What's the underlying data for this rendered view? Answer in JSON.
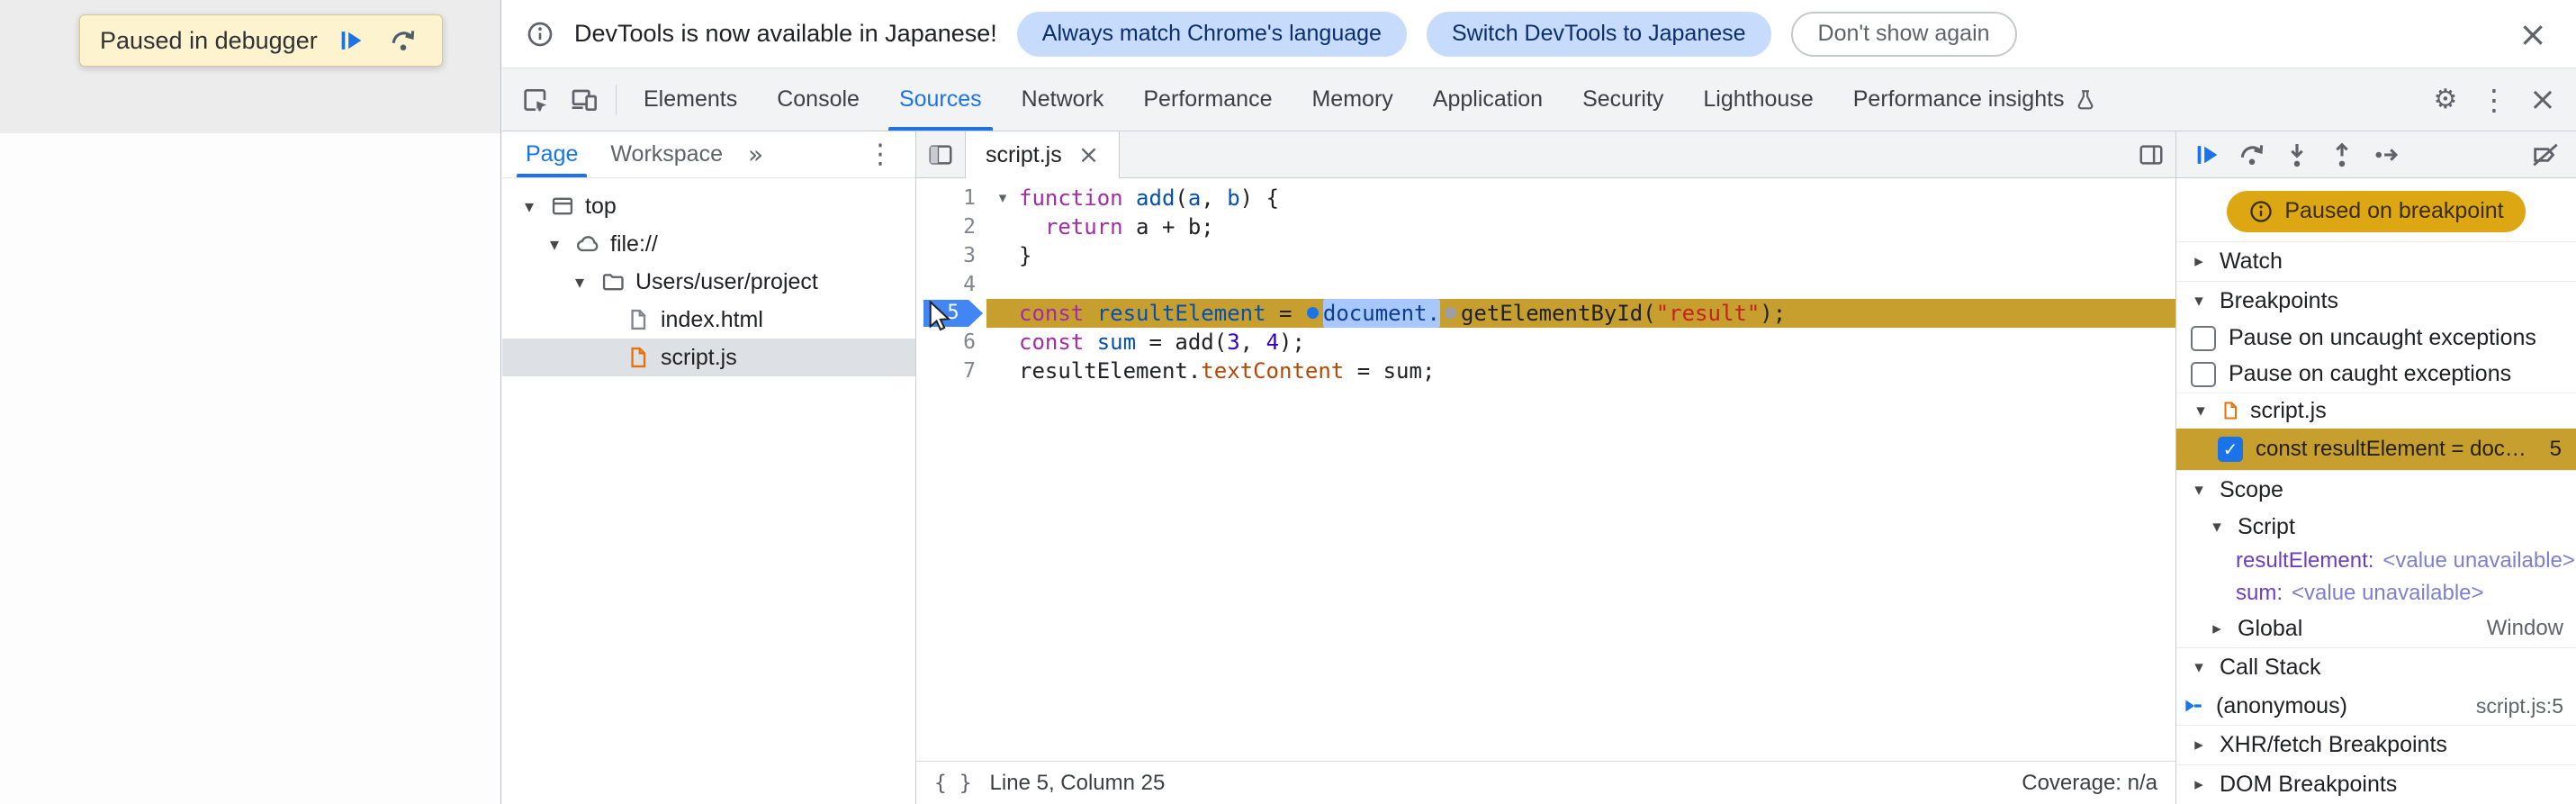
{
  "colors": {
    "accent": "#1a73e8",
    "paused_amber": "#c79f2f",
    "badge_blue": "#4285f4",
    "selection_blue": "#a8c7fa"
  },
  "icons": {
    "close": "×",
    "more_vert": "⋮",
    "gear": "⚙",
    "chevron_double": "»",
    "tri_down": "▾",
    "tri_right": "▸",
    "check": "✓",
    "braces": "{ }"
  },
  "page": {
    "paused_banner_text": "Paused in debugger"
  },
  "infobar": {
    "message": "DevTools is now available in Japanese!",
    "buttons": [
      {
        "label": "Always match Chrome's language"
      },
      {
        "label": "Switch DevTools to Japanese"
      },
      {
        "label": "Don't show again"
      }
    ]
  },
  "tabbar": {
    "selected": "Sources",
    "tabs": [
      {
        "label": "Elements"
      },
      {
        "label": "Console"
      },
      {
        "label": "Sources"
      },
      {
        "label": "Network"
      },
      {
        "label": "Performance"
      },
      {
        "label": "Memory"
      },
      {
        "label": "Application"
      },
      {
        "label": "Security"
      },
      {
        "label": "Lighthouse"
      },
      {
        "label": "Performance insights"
      }
    ]
  },
  "navigator": {
    "tabs": [
      {
        "label": "Page"
      },
      {
        "label": "Workspace"
      }
    ],
    "selected": "Page",
    "tree": [
      {
        "label": "top"
      },
      {
        "label": "file://"
      },
      {
        "label": "Users/user/project"
      },
      {
        "label": "index.html"
      },
      {
        "label": "script.js"
      }
    ]
  },
  "editor": {
    "tab_label": "script.js",
    "gutter": [
      "1",
      "2",
      "3",
      "4",
      "5",
      "6",
      "7"
    ],
    "paused_line": "5",
    "lines": [
      [
        "function",
        " ",
        "add",
        "(",
        "a",
        ", ",
        "b",
        ") {"
      ],
      [
        "  ",
        "return",
        " a + b;"
      ],
      [
        "}"
      ],
      [],
      [
        "const",
        " ",
        "resultElement",
        " = ",
        "document.",
        "getElementById(",
        "\"result\"",
        ");"
      ],
      [
        "const",
        " ",
        "sum",
        " = add(",
        "3",
        ", ",
        "4",
        ");"
      ],
      [
        "resultElement.",
        "textContent",
        " = sum;"
      ]
    ],
    "status_position": "Line 5, Column 25",
    "status_coverage": "Coverage: n/a"
  },
  "debugger": {
    "paused_badge": "Paused on breakpoint",
    "sections": {
      "watch": "Watch",
      "breakpoints": "Breakpoints",
      "scope": "Scope",
      "call_stack": "Call Stack",
      "xhr": "XHR/fetch Breakpoints",
      "dom": "DOM Breakpoints"
    },
    "breakpoints": {
      "checkbox1": "Pause on uncaught exceptions",
      "checkbox2": "Pause on caught exceptions",
      "group_file": "script.js",
      "entry": {
        "snippet": "const resultElement = doc…",
        "line": "5"
      }
    },
    "scope": {
      "script_label": "Script",
      "vars": [
        {
          "name": "resultElement:",
          "value": "<value unavailable>"
        },
        {
          "name": "sum:",
          "value": "<value unavailable>"
        }
      ],
      "global_label": "Global",
      "global_value": "Window"
    },
    "call_stack": {
      "frame_name": "(anonymous)",
      "frame_location": "script.js:5"
    }
  }
}
